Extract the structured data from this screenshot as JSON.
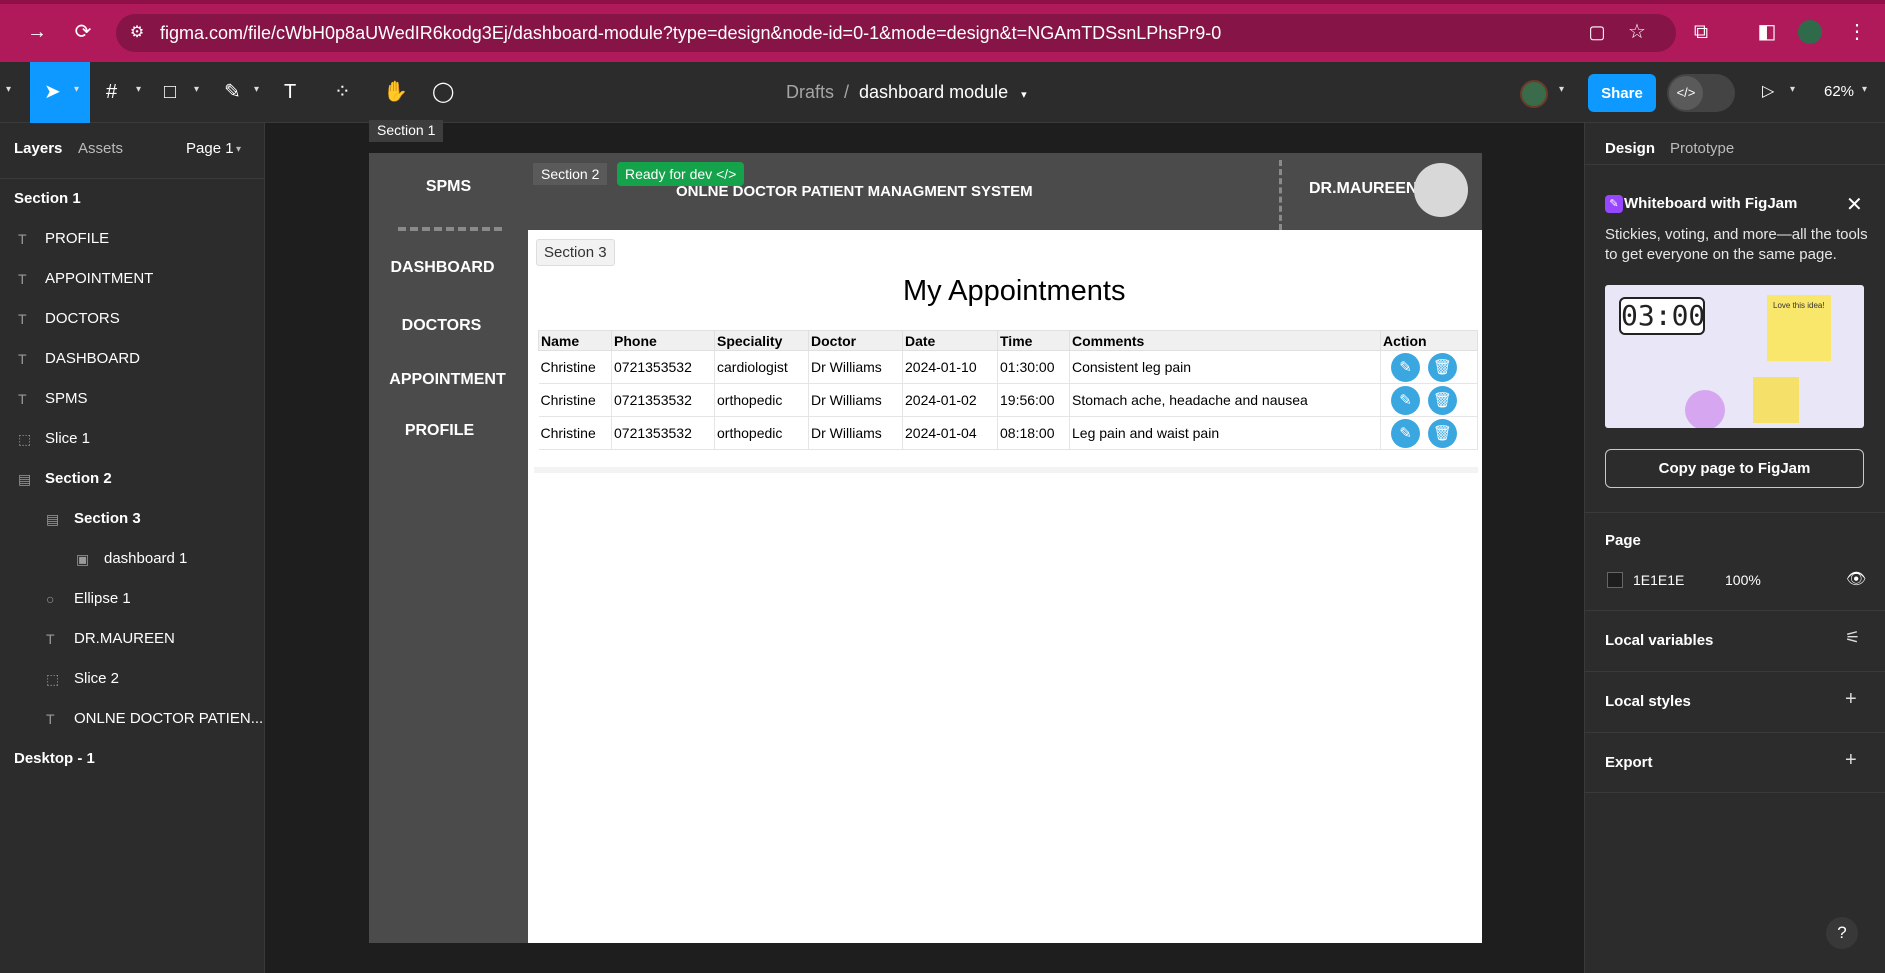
{
  "browser": {
    "url": "figma.com/file/cWbH0p8aUWedIR6kodg3Ej/dashboard-module?type=design&node-id=0-1&mode=design&t=NGAmTDSsnLPhsPr9-0"
  },
  "toolbar": {
    "breadcrumb_parent": "Drafts",
    "breadcrumb_sep": "/",
    "file_name": "dashboard module",
    "share_label": "Share",
    "zoom": "62%"
  },
  "left_panel": {
    "tabs": [
      "Layers",
      "Assets"
    ],
    "page_selector": "Page 1",
    "layers": [
      {
        "label": "Section 1",
        "icon": "none",
        "bold": true
      },
      {
        "label": "PROFILE",
        "icon": "text-icon"
      },
      {
        "label": "APPOINTMENT",
        "icon": "text-icon"
      },
      {
        "label": "DOCTORS",
        "icon": "text-icon"
      },
      {
        "label": "DASHBOARD",
        "icon": "text-icon"
      },
      {
        "label": "SPMS",
        "icon": "text-icon"
      },
      {
        "label": "Slice 1",
        "icon": "slice-icon"
      },
      {
        "label": "Section 2",
        "icon": "section-icon",
        "bold": true
      },
      {
        "label": "Section 3",
        "icon": "section-icon",
        "bold": true
      },
      {
        "label": "dashboard 1",
        "icon": "image-icon"
      },
      {
        "label": "Ellipse 1",
        "icon": "ellipse-icon"
      },
      {
        "label": "DR.MAUREEN",
        "icon": "text-icon"
      },
      {
        "label": "Slice 2",
        "icon": "slice-icon"
      },
      {
        "label": "ONLNE DOCTOR PATIEN...",
        "icon": "text-icon"
      },
      {
        "label": "Desktop - 1",
        "icon": "none",
        "bold": true
      }
    ]
  },
  "canvas": {
    "section1_label": "Section 1",
    "section2_label": "Section 2",
    "section3_label": "Section 3",
    "ready_badge": "Ready for dev",
    "sidebar": {
      "brand": "SPMS",
      "nav": [
        "DASHBOARD",
        "DOCTORS",
        "APPOINTMENT",
        "PROFILE"
      ]
    },
    "header": {
      "system_title": "ONLNE DOCTOR PATIENT MANAGMENT SYSTEM",
      "doctor_name": "DR.MAUREEN"
    },
    "page_heading": "My Appointments",
    "table": {
      "columns": [
        "Name",
        "Phone",
        "Speciality",
        "Doctor",
        "Date",
        "Time",
        "Comments",
        "Action"
      ],
      "rows": [
        [
          "Christine",
          "0721353532",
          "cardiologist",
          "Dr Williams",
          "2024-01-10",
          "01:30:00",
          "Consistent leg pain"
        ],
        [
          "Christine",
          "0721353532",
          "orthopedic",
          "Dr Williams",
          "2024-01-02",
          "19:56:00",
          "Stomach ache, headache and nausea"
        ],
        [
          "Christine",
          "0721353532",
          "orthopedic",
          "Dr Williams",
          "2024-01-04",
          "08:18:00",
          "Leg pain and waist pain"
        ]
      ],
      "action_icons": [
        "edit-icon",
        "delete-icon"
      ]
    }
  },
  "right_panel": {
    "tabs": [
      "Design",
      "Prototype"
    ],
    "figjam_title": "Whiteboard with FigJam",
    "figjam_desc": "Stickies, voting, and more—all the tools to get everyone on the same page.",
    "figjam_timer": "03:00",
    "figjam_note": "Love this idea!",
    "copy_button": "Copy page to FigJam",
    "page_section": "Page",
    "page_color": "1E1E1E",
    "page_opacity": "100%",
    "local_variables": "Local variables",
    "local_styles": "Local styles",
    "export": "Export",
    "help": "?"
  },
  "colors": {
    "browser_bar": "#b0195a",
    "figma_blue": "#0d99ff",
    "ready_green": "#14a34a",
    "sidebar_gray": "#4b4b4b",
    "action_blue": "#3aa7e0"
  }
}
